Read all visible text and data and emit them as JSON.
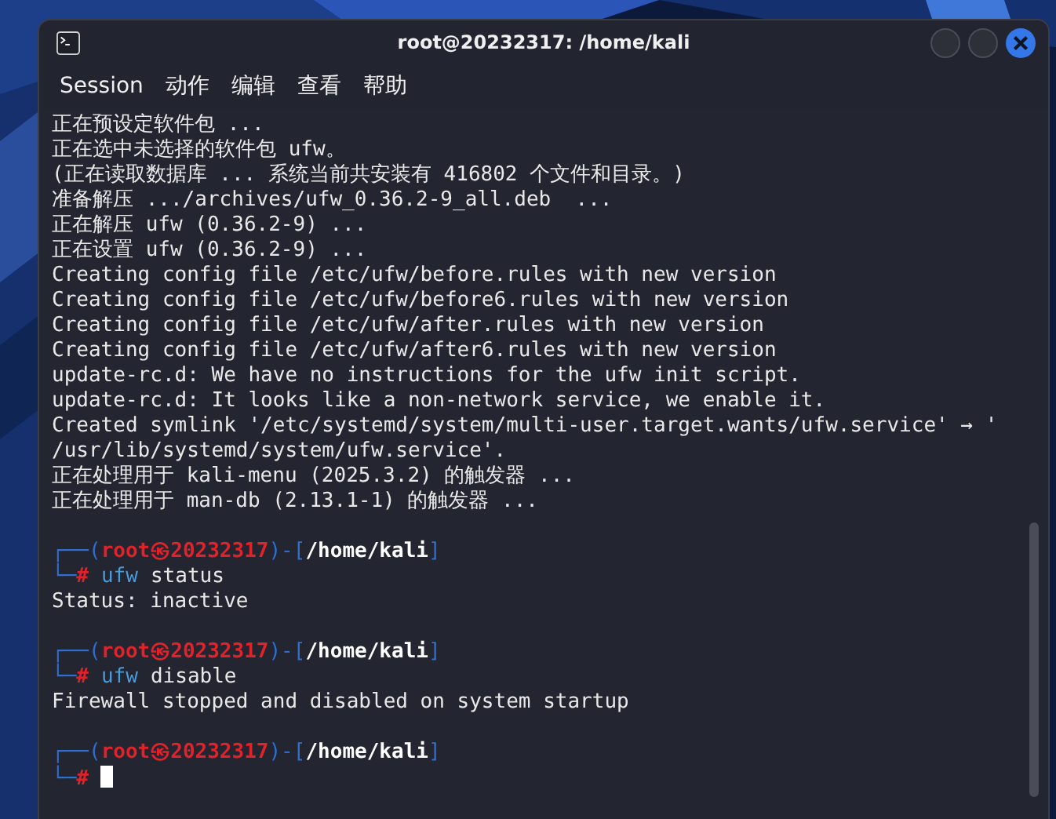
{
  "window": {
    "title": "root@20232317: /home/kali"
  },
  "menu": [
    {
      "label": "Session"
    },
    {
      "label": "动作"
    },
    {
      "label": "编辑"
    },
    {
      "label": "查看"
    },
    {
      "label": "帮助"
    }
  ],
  "terminal": [
    {
      "kind": "output",
      "text": "正在预设定软件包 ..."
    },
    {
      "kind": "output",
      "text": "正在选中未选择的软件包 ufw。"
    },
    {
      "kind": "output",
      "text": "(正在读取数据库 ... 系统当前共安装有 416802 个文件和目录。)"
    },
    {
      "kind": "output",
      "text": "准备解压 .../archives/ufw_0.36.2-9_all.deb  ..."
    },
    {
      "kind": "output",
      "text": "正在解压 ufw (0.36.2-9) ..."
    },
    {
      "kind": "output",
      "text": "正在设置 ufw (0.36.2-9) ..."
    },
    {
      "kind": "output",
      "text": "Creating config file /etc/ufw/before.rules with new version"
    },
    {
      "kind": "output",
      "text": "Creating config file /etc/ufw/before6.rules with new version"
    },
    {
      "kind": "output",
      "text": "Creating config file /etc/ufw/after.rules with new version"
    },
    {
      "kind": "output",
      "text": "Creating config file /etc/ufw/after6.rules with new version"
    },
    {
      "kind": "output",
      "text": "update-rc.d: We have no instructions for the ufw init script."
    },
    {
      "kind": "output",
      "text": "update-rc.d: It looks like a non-network service, we enable it."
    },
    {
      "kind": "output",
      "text": "Created symlink '/etc/systemd/system/multi-user.target.wants/ufw.service' → '"
    },
    {
      "kind": "output",
      "text": "/usr/lib/systemd/system/ufw.service'."
    },
    {
      "kind": "output",
      "text": "正在处理用于 kali-menu (2025.3.2) 的触发器 ..."
    },
    {
      "kind": "output",
      "text": "正在处理用于 man-db (2.13.1-1) 的触发器 ..."
    },
    {
      "kind": "blank"
    },
    {
      "kind": "prompt",
      "top": "┌──(",
      "user": "root",
      "at": "㉿",
      "host": "20232317",
      "mid": ")-[",
      "path": "/home/kali",
      "close": "]",
      "bottom": "└─",
      "symbol": "#",
      "program": "ufw",
      "args": "status",
      "cursor": false
    },
    {
      "kind": "output",
      "text": "Status: inactive"
    },
    {
      "kind": "blank"
    },
    {
      "kind": "prompt",
      "top": "┌──(",
      "user": "root",
      "at": "㉿",
      "host": "20232317",
      "mid": ")-[",
      "path": "/home/kali",
      "close": "]",
      "bottom": "└─",
      "symbol": "#",
      "program": "ufw",
      "args": "disable",
      "cursor": false
    },
    {
      "kind": "output",
      "text": "Firewall stopped and disabled on system startup"
    },
    {
      "kind": "blank"
    },
    {
      "kind": "prompt",
      "top": "┌──(",
      "user": "root",
      "at": "㉿",
      "host": "20232317",
      "mid": ")-[",
      "path": "/home/kali",
      "close": "]",
      "bottom": "└─",
      "symbol": "#",
      "cursor": true
    }
  ]
}
